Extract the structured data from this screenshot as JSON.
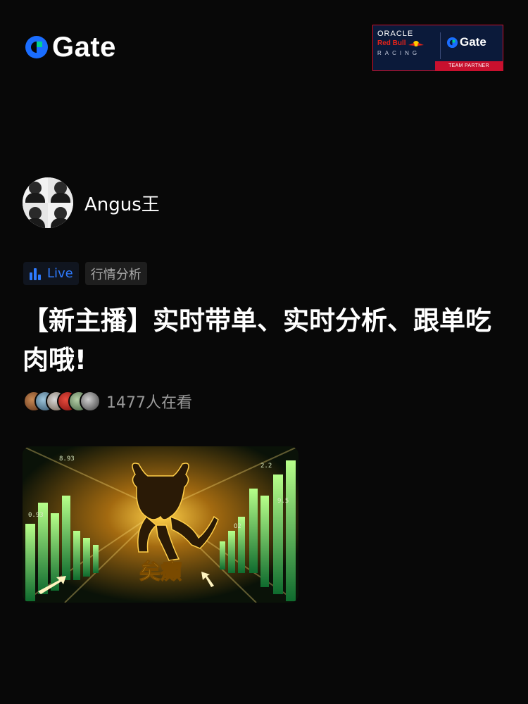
{
  "header": {
    "logo_text": "Gate",
    "partner": {
      "oracle": "ORACLE",
      "redbull": "Red Bull",
      "racing": "RACING",
      "gate": "Gate",
      "bar": "TEAM PARTNER"
    }
  },
  "streamer": {
    "name": "Angus王"
  },
  "tags": {
    "live": "Live",
    "category": "行情分析"
  },
  "stream": {
    "title": "【新主播】实时带单、实时分析、跟单吃肉哦!",
    "viewers": "1477人在看"
  },
  "thumbnail": {
    "caption": "矣癲"
  },
  "colors": {
    "accent": "#2e7bff",
    "gate_green": "#00d390",
    "gate_blue": "#1a6dff",
    "background": "#080808"
  },
  "icons": {
    "logo": "gate-logo-icon",
    "live": "bar-chart-icon"
  }
}
